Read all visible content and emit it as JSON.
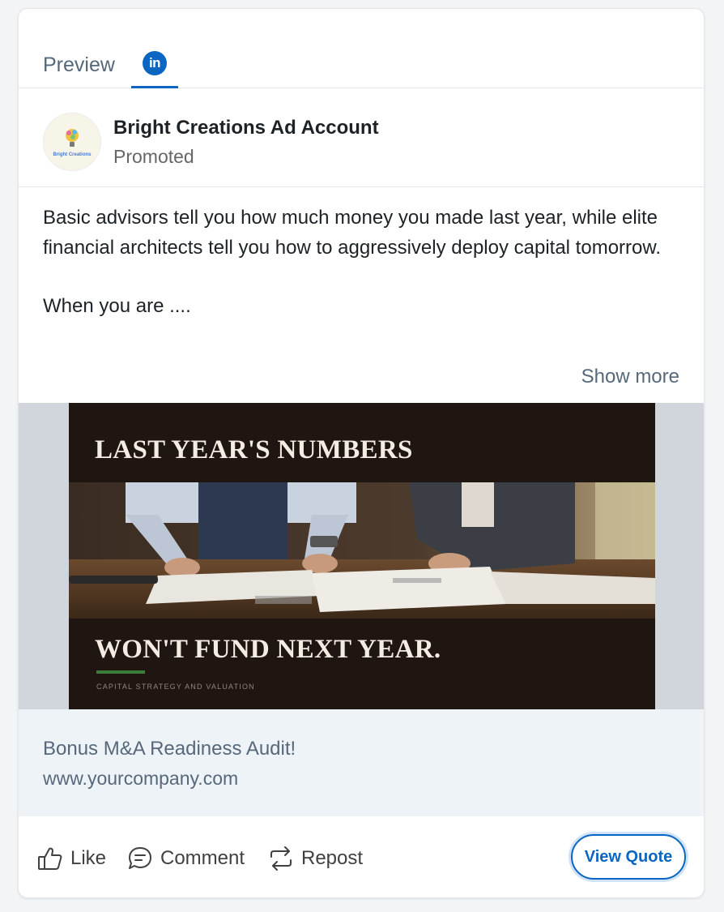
{
  "tabs": {
    "preview_label": "Preview",
    "linkedin_label": "in"
  },
  "post": {
    "account_name": "Bright Creations Ad Account",
    "account_logo_text": "Bright Creations",
    "sponsored_label": "Promoted",
    "text_paragraph_1": "Basic advisors tell you how much money you made last year, while elite financial architects tell you how to aggressively deploy capital tomorrow.",
    "text_paragraph_2": "When you are ....",
    "show_more_label": "Show more"
  },
  "creative": {
    "headline_top": "LAST YEAR'S NUMBERS",
    "headline_bottom": "WON'T FUND NEXT YEAR.",
    "subcaption": "CAPITAL STRATEGY AND VALUATION"
  },
  "link_preview": {
    "title": "Bonus M&A Readiness Audit!",
    "url": "www.yourcompany.com"
  },
  "actions": {
    "like_label": "Like",
    "comment_label": "Comment",
    "repost_label": "Repost",
    "cta_label": "View Quote"
  },
  "colors": {
    "linkedin_blue": "#0a66c2",
    "creative_background": "#1f1611",
    "accent_green": "#3d7d3a",
    "link_box_background": "#eef3f8"
  },
  "icons": [
    "linkedin-icon",
    "lightbulb-logo",
    "like-icon",
    "comment-icon",
    "repost-icon"
  ]
}
